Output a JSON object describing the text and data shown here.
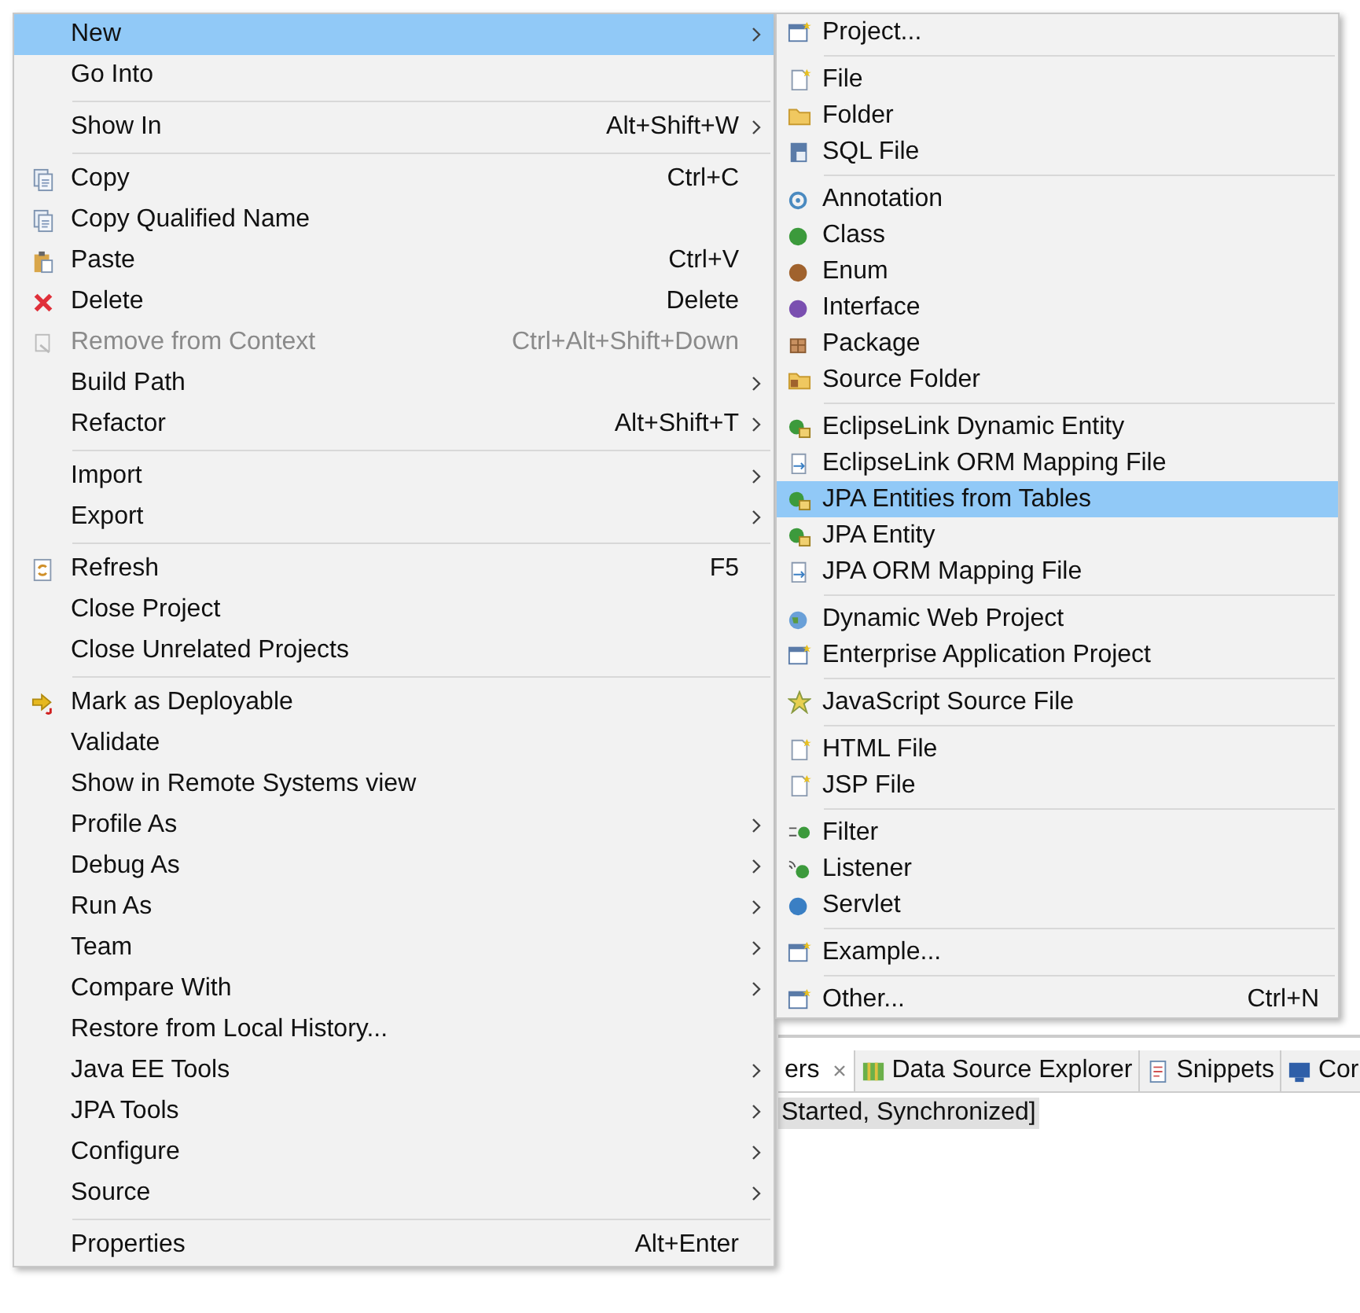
{
  "context_menu": {
    "groups": [
      [
        {
          "label": "New",
          "submenu": true,
          "selected": true,
          "disabled": false
        },
        {
          "label": "Go Into",
          "submenu": false,
          "selected": false,
          "disabled": false
        }
      ],
      [
        {
          "label": "Show In",
          "shortcut": "Alt+Shift+W",
          "submenu": true,
          "selected": false,
          "disabled": false
        }
      ],
      [
        {
          "label": "Copy",
          "shortcut": "Ctrl+C",
          "kind": "copy",
          "submenu": false,
          "selected": false,
          "disabled": false
        },
        {
          "label": "Copy Qualified Name",
          "kind": "copy",
          "submenu": false,
          "selected": false,
          "disabled": false
        },
        {
          "label": "Paste",
          "shortcut": "Ctrl+V",
          "kind": "paste",
          "submenu": false,
          "selected": false,
          "disabled": false
        },
        {
          "label": "Delete",
          "shortcut": "Delete",
          "kind": "delete",
          "submenu": false,
          "selected": false,
          "disabled": false
        },
        {
          "label": "Remove from Context",
          "shortcut": "Ctrl+Alt+Shift+Down",
          "kind": "remove",
          "submenu": false,
          "selected": false,
          "disabled": true
        },
        {
          "label": "Build Path",
          "submenu": true,
          "selected": false,
          "disabled": false
        },
        {
          "label": "Refactor",
          "shortcut": "Alt+Shift+T",
          "submenu": true,
          "selected": false,
          "disabled": false
        }
      ],
      [
        {
          "label": "Import",
          "submenu": true,
          "selected": false,
          "disabled": false
        },
        {
          "label": "Export",
          "submenu": true,
          "selected": false,
          "disabled": false
        }
      ],
      [
        {
          "label": "Refresh",
          "shortcut": "F5",
          "kind": "refresh",
          "submenu": false,
          "selected": false,
          "disabled": false
        },
        {
          "label": "Close Project",
          "submenu": false,
          "selected": false,
          "disabled": false
        },
        {
          "label": "Close Unrelated Projects",
          "submenu": false,
          "selected": false,
          "disabled": false
        }
      ],
      [
        {
          "label": "Mark as Deployable",
          "kind": "deploy",
          "submenu": false,
          "selected": false,
          "disabled": false
        },
        {
          "label": "Validate",
          "submenu": false,
          "selected": false,
          "disabled": false
        },
        {
          "label": "Show in Remote Systems view",
          "submenu": false,
          "selected": false,
          "disabled": false
        },
        {
          "label": "Profile As",
          "submenu": true,
          "selected": false,
          "disabled": false
        },
        {
          "label": "Debug As",
          "submenu": true,
          "selected": false,
          "disabled": false
        },
        {
          "label": "Run As",
          "submenu": true,
          "selected": false,
          "disabled": false
        },
        {
          "label": "Team",
          "submenu": true,
          "selected": false,
          "disabled": false
        },
        {
          "label": "Compare With",
          "submenu": true,
          "selected": false,
          "disabled": false
        },
        {
          "label": "Restore from Local History...",
          "submenu": false,
          "selected": false,
          "disabled": false
        },
        {
          "label": "Java EE Tools",
          "submenu": true,
          "selected": false,
          "disabled": false
        },
        {
          "label": "JPA Tools",
          "submenu": true,
          "selected": false,
          "disabled": false
        },
        {
          "label": "Configure",
          "submenu": true,
          "selected": false,
          "disabled": false
        },
        {
          "label": "Source",
          "submenu": true,
          "selected": false,
          "disabled": false
        }
      ],
      [
        {
          "label": "Properties",
          "shortcut": "Alt+Enter",
          "submenu": false,
          "selected": false,
          "disabled": false
        }
      ]
    ]
  },
  "new_submenu": {
    "groups": [
      [
        {
          "label": "Project...",
          "kind": "window",
          "selected": false
        }
      ],
      [
        {
          "label": "File",
          "kind": "file",
          "selected": false
        },
        {
          "label": "Folder",
          "kind": "folder",
          "selected": false
        },
        {
          "label": "SQL File",
          "kind": "sql",
          "selected": false
        }
      ],
      [
        {
          "label": "Annotation",
          "kind": "ring",
          "selected": false
        },
        {
          "label": "Class",
          "kind": "circle",
          "color": "#3c9a3c",
          "selected": false
        },
        {
          "label": "Enum",
          "kind": "circle",
          "color": "#a0622d",
          "selected": false
        },
        {
          "label": "Interface",
          "kind": "circle",
          "color": "#7a4fb0",
          "selected": false
        },
        {
          "label": "Package",
          "kind": "package",
          "selected": false
        },
        {
          "label": "Source Folder",
          "kind": "srcfolder",
          "selected": false
        }
      ],
      [
        {
          "label": "EclipseLink Dynamic Entity",
          "kind": "entity",
          "selected": false
        },
        {
          "label": "EclipseLink ORM Mapping File",
          "kind": "orm",
          "selected": false
        },
        {
          "label": "JPA Entities from Tables",
          "kind": "entity",
          "selected": true
        },
        {
          "label": "JPA Entity",
          "kind": "entity",
          "selected": false
        },
        {
          "label": "JPA ORM Mapping File",
          "kind": "orm",
          "selected": false
        }
      ],
      [
        {
          "label": "Dynamic Web Project",
          "kind": "globe",
          "selected": false
        },
        {
          "label": "Enterprise Application Project",
          "kind": "window",
          "selected": false
        }
      ],
      [
        {
          "label": "JavaScript Source File",
          "kind": "star",
          "selected": false
        }
      ],
      [
        {
          "label": "HTML File",
          "kind": "file",
          "selected": false
        },
        {
          "label": "JSP File",
          "kind": "file",
          "selected": false
        }
      ],
      [
        {
          "label": "Filter",
          "kind": "filter",
          "selected": false
        },
        {
          "label": "Listener",
          "kind": "listener",
          "selected": false
        },
        {
          "label": "Servlet",
          "kind": "circle",
          "color": "#3a7fc4",
          "selected": false
        }
      ],
      [
        {
          "label": "Example...",
          "kind": "window",
          "selected": false
        }
      ],
      [
        {
          "label": "Other...",
          "shortcut": "Ctrl+N",
          "kind": "window",
          "selected": false
        }
      ]
    ]
  },
  "view_tabs": [
    {
      "label": "ers",
      "closable": true,
      "selected": true
    },
    {
      "label": "Data Source Explorer",
      "closable": false,
      "kind": "map",
      "selected": false
    },
    {
      "label": "Snippets",
      "closable": false,
      "kind": "snippet",
      "selected": false
    },
    {
      "label": "Cor",
      "closable": false,
      "kind": "monitor",
      "selected": false
    }
  ],
  "server_status": "Started, Synchronized]"
}
